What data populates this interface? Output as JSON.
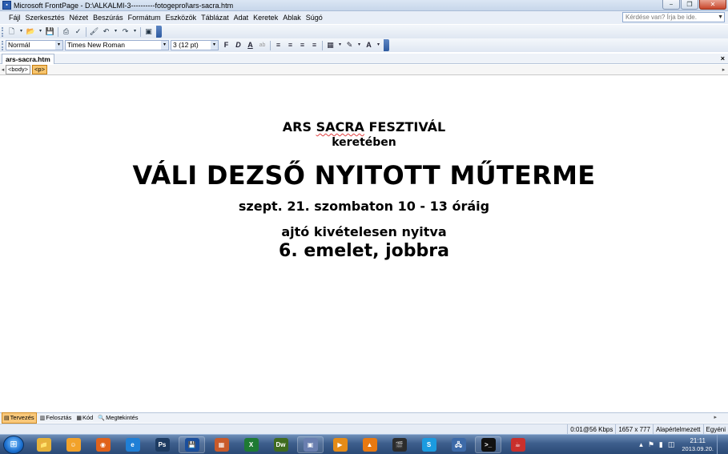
{
  "window": {
    "title": "Microsoft FrontPage - D:\\ALKALMI-3----------fotogeprol\\ars-sacra.htm",
    "app_icon": "frontpage-icon",
    "controls": {
      "minimize": "−",
      "restore": "❐",
      "close": "✕"
    }
  },
  "menu": {
    "items": [
      "Fájl",
      "Szerkesztés",
      "Nézet",
      "Beszúrás",
      "Formátum",
      "Eszközök",
      "Táblázat",
      "Adat",
      "Keretek",
      "Ablak",
      "Súgó"
    ],
    "help_placeholder": "Kérdése van? Írja be ide.",
    "help_arrow": "▼"
  },
  "toolbar_standard": {
    "icons": [
      {
        "name": "new-page-icon",
        "glyph": "🗋"
      },
      {
        "name": "dropdown-arrow-icon",
        "glyph": "▾",
        "small": true
      },
      {
        "name": "open-folder-icon",
        "glyph": "📂"
      },
      {
        "name": "dropdown-arrow-icon",
        "glyph": "▾",
        "small": true
      },
      {
        "name": "save-icon",
        "glyph": "💾"
      },
      {
        "name": "sep"
      },
      {
        "name": "print-icon",
        "glyph": "⎙"
      },
      {
        "name": "spelling-icon",
        "glyph": "✓"
      },
      {
        "name": "sep"
      },
      {
        "name": "format-painter-icon",
        "glyph": "🖌"
      },
      {
        "name": "undo-icon",
        "glyph": "↶"
      },
      {
        "name": "dropdown-arrow-icon",
        "glyph": "▾",
        "small": true
      },
      {
        "name": "redo-icon",
        "glyph": "↷"
      },
      {
        "name": "dropdown-arrow-icon",
        "glyph": "▾",
        "small": true
      },
      {
        "name": "sep"
      },
      {
        "name": "insert-picture-icon",
        "glyph": "▣"
      }
    ]
  },
  "toolbar_format": {
    "style": "Normál",
    "font": "Times New Roman",
    "size": "3 (12 pt)",
    "combo_arrow": "▾",
    "buttons": [
      {
        "name": "bold-button",
        "glyph": "F"
      },
      {
        "name": "italic-button",
        "glyph": "D"
      },
      {
        "name": "underline-button",
        "glyph": "A"
      },
      {
        "name": "highlight-text-icon",
        "glyph": "ab"
      },
      {
        "name": "sep"
      },
      {
        "name": "align-left-icon",
        "glyph": "≡"
      },
      {
        "name": "align-center-icon",
        "glyph": "≡"
      },
      {
        "name": "align-right-icon",
        "glyph": "≡"
      },
      {
        "name": "justify-icon",
        "glyph": "≡"
      },
      {
        "name": "sep"
      },
      {
        "name": "borders-icon",
        "glyph": "▦"
      },
      {
        "name": "dropdown-arrow-icon",
        "glyph": "▾",
        "small": true
      },
      {
        "name": "highlight-color-icon",
        "glyph": "✎"
      },
      {
        "name": "dropdown-arrow-icon",
        "glyph": "▾",
        "small": true
      },
      {
        "name": "font-color-icon",
        "glyph": "A"
      },
      {
        "name": "dropdown-arrow-icon",
        "glyph": "▾",
        "small": true
      }
    ]
  },
  "document_tab": {
    "label": "ars-sacra.htm",
    "close": "×"
  },
  "tag_selector": {
    "left_arrow": "◂",
    "right_arrow": "▸",
    "tags": [
      "<body>",
      "<p>"
    ]
  },
  "content": {
    "line1_prefix": "ARS ",
    "line1_underlined": "SACRA",
    "line1_suffix": " FESZTIVÁL",
    "line2": "keretében",
    "line3": "VÁLI DEZSŐ NYITOTT MŰTERME",
    "line4": "szept. 21. szombaton 10 - 13 óráig",
    "line5": "ajtó kivételesen nyitva",
    "line6": "6. emelet, jobbra"
  },
  "view_tabs": [
    {
      "label": "Tervezés",
      "icon": "design-view-icon",
      "glyph": "▤",
      "active": true
    },
    {
      "label": "Felosztás",
      "icon": "split-view-icon",
      "glyph": "▥",
      "active": false
    },
    {
      "label": "Kód",
      "icon": "code-view-icon",
      "glyph": "▦",
      "active": false
    },
    {
      "label": "Megtekintés",
      "icon": "preview-view-icon",
      "glyph": "🔍",
      "active": false
    }
  ],
  "scroll_arrows": {
    "left": "◂",
    "right": "▸"
  },
  "status_bar": {
    "download_time": "0:01@56 Kbps",
    "page_size": "1657 x 777",
    "mode": "Alapértelmezett",
    "custom": "Egyéni"
  },
  "taskbar": {
    "start_glyph": "⊞",
    "apps": [
      {
        "name": "explorer-app",
        "label": "📁",
        "color": "#e6b23a",
        "pinned": false
      },
      {
        "name": "messenger-app",
        "label": "☺",
        "color": "#f2a22a",
        "pinned": false
      },
      {
        "name": "firefox-app",
        "label": "◉",
        "color": "#e0621b",
        "pinned": false
      },
      {
        "name": "ie-app",
        "label": "e",
        "color": "#1f7fd6",
        "pinned": false
      },
      {
        "name": "photoshop-app",
        "label": "Ps",
        "color": "#1d3b62",
        "pinned": false
      },
      {
        "name": "frontpage-app",
        "label": "💾",
        "color": "#1a4e9c",
        "pinned": true
      },
      {
        "name": "package-app",
        "label": "▦",
        "color": "#c95a2a",
        "pinned": false
      },
      {
        "name": "excel-app",
        "label": "X",
        "color": "#1e7a33",
        "pinned": false
      },
      {
        "name": "dreamweaver-app",
        "label": "Dw",
        "color": "#3f6b1f",
        "pinned": false
      },
      {
        "name": "paint-app",
        "label": "▣",
        "color": "#6a7fb0",
        "pinned": true
      },
      {
        "name": "media-app",
        "label": "▶",
        "color": "#e58b17",
        "pinned": false
      },
      {
        "name": "vlc-app",
        "label": "▲",
        "color": "#e87911",
        "pinned": false
      },
      {
        "name": "movie-app",
        "label": "🎬",
        "color": "#2c2c2c",
        "pinned": false
      },
      {
        "name": "skype-app",
        "label": "S",
        "color": "#1b9be0",
        "pinned": false
      },
      {
        "name": "network-app",
        "label": "🖧",
        "color": "#3d6aa8",
        "pinned": false
      },
      {
        "name": "cmd-app",
        "label": ">_",
        "color": "#111111",
        "pinned": true
      },
      {
        "name": "java-app",
        "label": "☕",
        "color": "#c9302c",
        "pinned": false
      }
    ],
    "tray_icons": [
      {
        "name": "tray-arrow-icon",
        "glyph": "▴"
      },
      {
        "name": "flag-icon",
        "glyph": "⚑"
      },
      {
        "name": "network-tray-icon",
        "glyph": "▮"
      },
      {
        "name": "volume-icon",
        "glyph": "◫"
      }
    ],
    "clock_time": "21:11",
    "clock_date": "2013.09.20."
  }
}
